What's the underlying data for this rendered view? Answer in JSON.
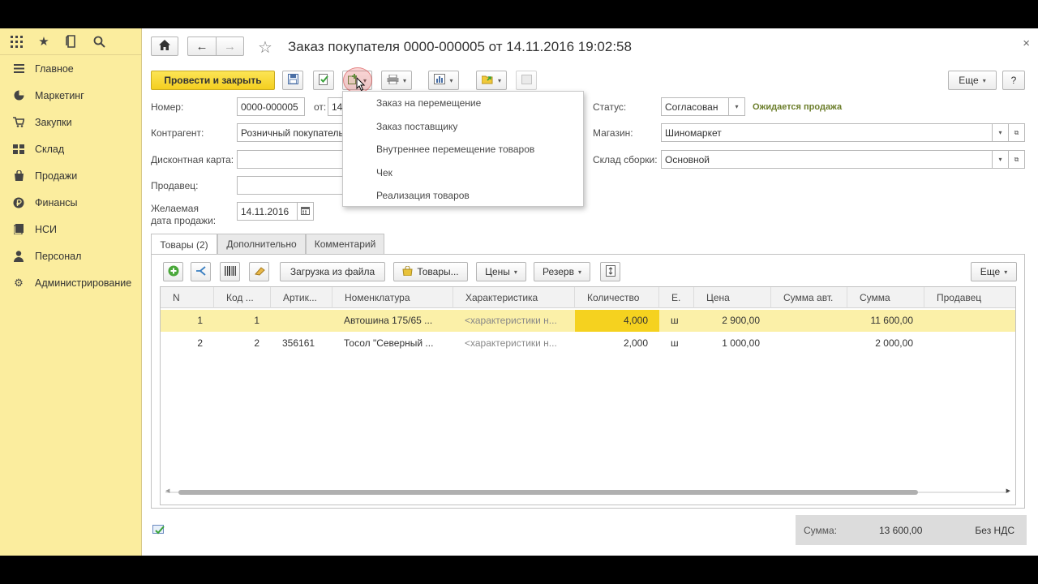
{
  "sidebar": {
    "items": [
      {
        "label": "Главное",
        "icon": "menu-icon"
      },
      {
        "label": "Маркетинг",
        "icon": "pie-chart-icon"
      },
      {
        "label": "Закупки",
        "icon": "cart-icon"
      },
      {
        "label": "Склад",
        "icon": "warehouse-icon"
      },
      {
        "label": "Продажи",
        "icon": "shopping-bag-icon"
      },
      {
        "label": "Финансы",
        "icon": "ruble-icon"
      },
      {
        "label": "НСИ",
        "icon": "reference-icon"
      },
      {
        "label": "Персонал",
        "icon": "person-icon"
      },
      {
        "label": "Администрирование",
        "icon": "gear-icon"
      }
    ]
  },
  "header": {
    "title": "Заказ покупателя 0000-000005 от 14.11.2016 19:02:58"
  },
  "toolbar": {
    "post_close_label": "Провести и закрыть",
    "more_label": "Еще",
    "help_label": "?"
  },
  "form": {
    "number_label": "Номер:",
    "number_value": "0000-000005",
    "from_label": "от:",
    "from_value": "14",
    "counterparty_label": "Контрагент:",
    "counterparty_value": "Розничный покупатель",
    "discount_card_label": "Дисконтная карта:",
    "discount_card_value": "",
    "seller_label": "Продавец:",
    "seller_value": "",
    "desired_date_label_1": "Желаемая",
    "desired_date_label_2": "дата продажи:",
    "desired_date_value": "14.11.2016",
    "status_label": "Статус:",
    "status_value": "Согласован",
    "status_note": "Ожидается продажа",
    "store_label": "Магазин:",
    "store_value": "Шиномаркет",
    "assembly_wh_label": "Склад сборки:",
    "assembly_wh_value": "Основной"
  },
  "dropdown_menu": {
    "items": [
      "Заказ на перемещение",
      "Заказ поставщику",
      "Внутреннее перемещение товаров",
      "Чек",
      "Реализация товаров"
    ]
  },
  "tabs": [
    {
      "label": "Товары (2)",
      "active": true
    },
    {
      "label": "Дополнительно",
      "active": false
    },
    {
      "label": "Комментарий",
      "active": false
    }
  ],
  "table_toolbar": {
    "load_from_file": "Загрузка из файла",
    "goods": "Товары...",
    "prices": "Цены",
    "reserve": "Резерв",
    "more": "Еще"
  },
  "table": {
    "columns": [
      "N",
      "Код ...",
      "Артик...",
      "Номенклатура",
      "Характеристика",
      "Количество",
      "Е.",
      "Цена",
      "Сумма авт.",
      "Сумма",
      "Продавец"
    ],
    "rows": [
      {
        "n": "1",
        "code": "1",
        "article": "",
        "item": "Автошина 175/65 ...",
        "characteristic": "<характеристики н...",
        "qty": "4,000",
        "unit": "ш",
        "price": "2 900,00",
        "auto_sum": "",
        "sum": "11 600,00",
        "seller": ""
      },
      {
        "n": "2",
        "code": "2",
        "article": "356161",
        "item": "Тосол \"Северный ...",
        "characteristic": "<характеристики н...",
        "qty": "2,000",
        "unit": "ш",
        "price": "1 000,00",
        "auto_sum": "",
        "sum": "2 000,00",
        "seller": ""
      }
    ]
  },
  "footer": {
    "sum_label": "Сумма:",
    "sum_value": "13 600,00",
    "vat_label": "Без НДС"
  },
  "colors": {
    "sidebar_bg": "#fbed9e",
    "primary_button": "#f4cf1f",
    "selected_row": "#fbf0a8",
    "highlight_cell": "#f5d21f",
    "status_note": "#6b7d2a"
  }
}
